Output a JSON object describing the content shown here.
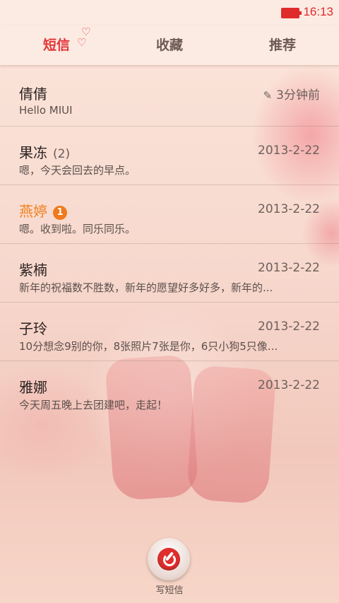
{
  "status_bar": {
    "time": "16:13"
  },
  "tabs": [
    {
      "label": "短信",
      "active": true
    },
    {
      "label": "收藏",
      "active": false
    },
    {
      "label": "推荐",
      "active": false
    }
  ],
  "conversations": [
    {
      "name": "倩倩",
      "count": "",
      "badge": "",
      "time": "3分钟前",
      "draft": true,
      "preview": "Hello MIUI"
    },
    {
      "name": "果冻",
      "count": "(2)",
      "badge": "",
      "time": "2013-2-22",
      "draft": false,
      "preview": "嗯，今天会回去的早点。"
    },
    {
      "name": "燕婷",
      "count": "",
      "badge": "1",
      "time": "2013-2-22",
      "draft": false,
      "preview": "嗯。收到啦。同乐同乐。"
    },
    {
      "name": "紫楠",
      "count": "",
      "badge": "",
      "time": "2013-2-22",
      "draft": false,
      "preview": "新年的祝福数不胜数，新年的愿望好多好多，新年的..."
    },
    {
      "name": "子玲",
      "count": "",
      "badge": "",
      "time": "2013-2-22",
      "draft": false,
      "preview": "10分想念9别的你，8张照片7张是你，6只小狗5只像..."
    },
    {
      "name": "雅娜",
      "count": "",
      "badge": "",
      "time": "2013-2-22",
      "draft": false,
      "preview": "今天周五晚上去团建吧，走起！"
    }
  ],
  "compose": {
    "label": "写短信",
    "icon": "compose-icon"
  },
  "colors": {
    "accent": "#e4353a",
    "unread": "#f0801f",
    "badge": "#f07a1c"
  }
}
